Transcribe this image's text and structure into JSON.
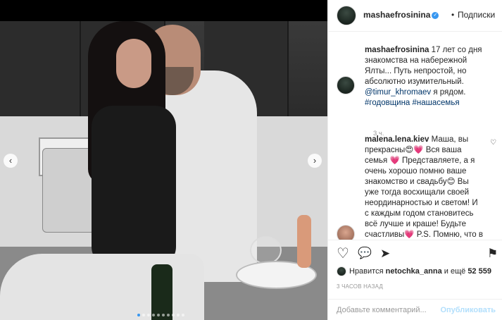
{
  "post": {
    "username": "mashaefrosinina",
    "verified_icon": "verified-badge-icon",
    "separator": "•",
    "follow_label": "Подписки"
  },
  "caption": {
    "username": "mashaefrosinina",
    "text_before_mention": " 17 лет со дня знакомства на набережной Ялты... Путь непростой, но абсолютно изумительный.",
    "mention": "@timur_khromaev",
    "text_after_mention": " я рядом.",
    "hashtags": "#годовщина #нашасемья",
    "time": "3 ч."
  },
  "comment": {
    "username": "malena.lena.kiev",
    "text": " Маша, вы прекрасны😍💗 Вся ваша семья 💗 Представляете, а я очень хорошо помню ваше знакомство и свадьбу😊 Вы уже тогда восхищали своей неординарностью и светом! И с каждым годом становитесь всё лучше и краше! Будьте счастливы💗 P.S. Помню, что в то время имя Тимур было"
  },
  "actions": {
    "like_icon": "♡",
    "comment_icon": "💬",
    "share_icon": "➤",
    "save_icon": "⚑"
  },
  "likes": {
    "prefix": "Нравится ",
    "user": "netochka_anna",
    "suffix": " и ещё ",
    "count": "52 559"
  },
  "posted_ago": "3 ЧАСОВ НАЗАД",
  "comment_input": {
    "placeholder": "Добавьте комментарий...",
    "publish_label": "Опубликовать"
  },
  "carousel": {
    "prev": "‹",
    "next": "›",
    "slides": 10,
    "active_index": 0
  }
}
